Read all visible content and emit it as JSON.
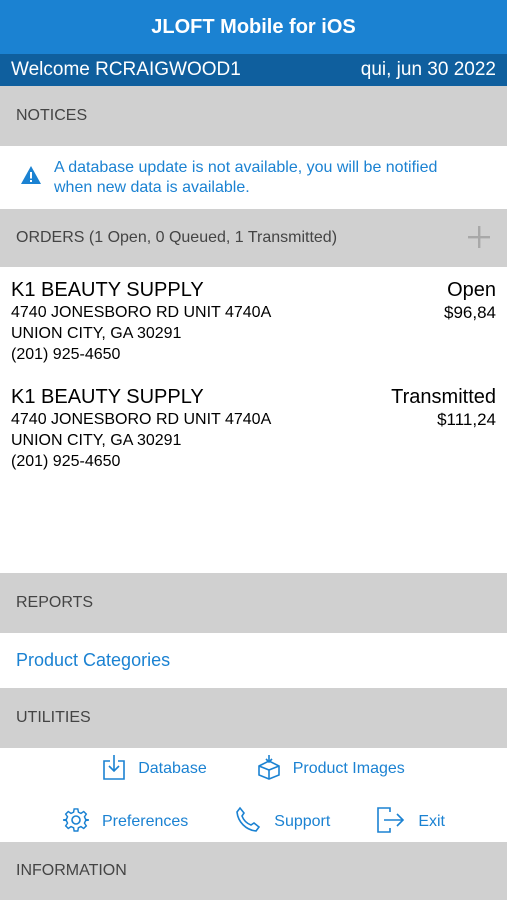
{
  "nav": {
    "title": "JLOFT Mobile for iOS"
  },
  "welcome": {
    "greeting": "Welcome RCRAIGWOOD1",
    "date": "qui, jun 30 2022"
  },
  "notices": {
    "header": "NOTICES",
    "message_line1": "A database update is not available, you will be notified",
    "message_line2": "when new data is available.",
    "icon": "warning-icon"
  },
  "orders": {
    "header": "ORDERS (1 Open, 0 Queued, 1 Transmitted)",
    "add_icon": "plus-icon",
    "items": [
      {
        "customer": "K1 BEAUTY SUPPLY",
        "address1": "4740 JONESBORO RD UNIT 4740A",
        "address2": "UNION CITY, GA 30291",
        "phone": "(201) 925-4650",
        "status": "Open",
        "amount": "$96,84"
      },
      {
        "customer": "K1 BEAUTY SUPPLY",
        "address1": "4740 JONESBORO RD UNIT 4740A",
        "address2": "UNION CITY, GA 30291",
        "phone": "(201) 925-4650",
        "status": "Transmitted",
        "amount": "$111,24"
      }
    ]
  },
  "reports": {
    "header": "REPORTS",
    "link": "Product Categories"
  },
  "utilities": {
    "header": "UTILITIES",
    "database": "Database",
    "product_images": "Product Images",
    "preferences": "Preferences",
    "support": "Support",
    "exit": "Exit"
  },
  "information": {
    "header": "INFORMATION"
  },
  "colors": {
    "accent": "#1b82d2",
    "nav_bg": "#1b82d2",
    "welcome_bg": "#0f5f9e",
    "section_bg": "#d0d0d0"
  }
}
